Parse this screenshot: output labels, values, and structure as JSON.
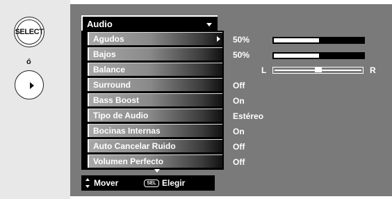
{
  "remote": {
    "select_label": "SELECT",
    "or_label": "ó"
  },
  "menu": {
    "header": "Audio",
    "items": [
      {
        "label": "Agudos",
        "value": "50%",
        "level": 0.5,
        "selected": true
      },
      {
        "label": "Bajos",
        "value": "50%",
        "level": 0.5
      },
      {
        "label": "Balance",
        "value": ""
      },
      {
        "label": "Surround",
        "value": "Off"
      },
      {
        "label": "Bass Boost",
        "value": "On"
      },
      {
        "label": "Tipo de Audio",
        "value": "Estéreo"
      },
      {
        "label": "Bocinas Internas",
        "value": "On"
      },
      {
        "label": "Auto Cancelar Ruido",
        "value": "Off"
      },
      {
        "label": "Volumen Perfecto",
        "value": "Off"
      }
    ],
    "balance": {
      "left_label": "L",
      "right_label": "R",
      "position": 0.5
    }
  },
  "footer": {
    "move_label": "Mover",
    "sel_key": "SEL",
    "choose_label": "Elegir"
  },
  "colors": {
    "panel": "#7a7a7a",
    "menu_bg": "#000000",
    "text": "#ffffff"
  }
}
